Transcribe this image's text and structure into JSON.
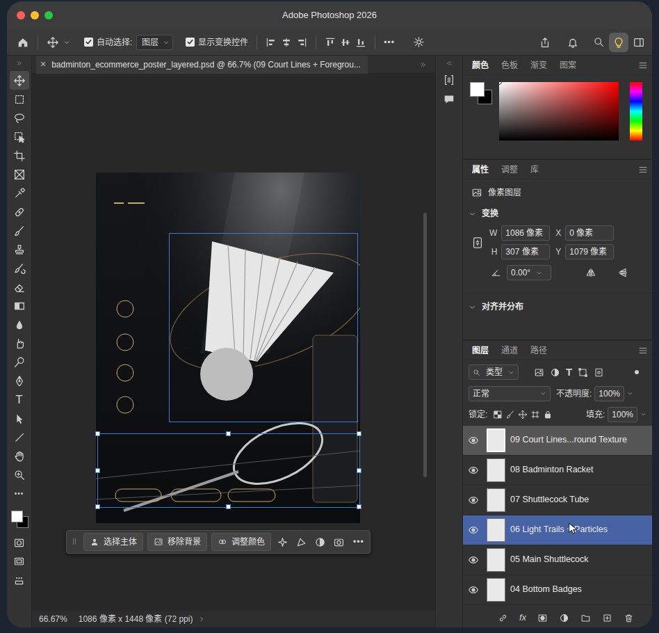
{
  "window": {
    "title": "Adobe Photoshop 2026"
  },
  "options_bar": {
    "auto_select": {
      "label": "自动选择:",
      "checked": true,
      "value": "图层"
    },
    "show_transform": {
      "label": "显示变换控件",
      "checked": true
    },
    "more": "•••",
    "discover_active": true
  },
  "document": {
    "tab": "badminton_ecommerce_poster_layered.psd @ 66.7% (09 Court Lines + Foregrou...",
    "close": "×"
  },
  "toolbar": {
    "tools": [
      {
        "kind": "move",
        "selected": true
      },
      {
        "kind": "marquee",
        "selected": false
      },
      {
        "kind": "lasso",
        "selected": false
      },
      {
        "kind": "object-select",
        "selected": false
      },
      {
        "kind": "crop",
        "selected": false
      },
      {
        "kind": "frame",
        "selected": false
      },
      {
        "kind": "eyedropper",
        "selected": false
      },
      {
        "kind": "healing",
        "selected": false
      },
      {
        "kind": "brush",
        "selected": false
      },
      {
        "kind": "stamp",
        "selected": false
      },
      {
        "kind": "history-brush",
        "selected": false
      },
      {
        "kind": "eraser",
        "selected": false
      },
      {
        "kind": "gradient",
        "selected": false
      },
      {
        "kind": "blur",
        "selected": false
      },
      {
        "kind": "smudge",
        "selected": false
      },
      {
        "kind": "dodge",
        "selected": false
      },
      {
        "kind": "pen",
        "selected": false
      },
      {
        "kind": "type",
        "label": "T",
        "selected": false
      },
      {
        "kind": "path-select",
        "selected": false
      },
      {
        "kind": "line",
        "selected": false
      },
      {
        "kind": "hand",
        "selected": false
      },
      {
        "kind": "zoom",
        "selected": false
      },
      {
        "kind": "more",
        "label": "•••",
        "selected": false
      }
    ],
    "foreground": "#ffffff",
    "background": "#000000"
  },
  "task_bar": {
    "buttons": [
      {
        "label": "选择主体"
      },
      {
        "label": "移除背景"
      },
      {
        "label": "调整颜色"
      }
    ],
    "more": "•••"
  },
  "status_bar": {
    "zoom": "66.67%",
    "info": "1086 像素 x 1448 像素 (72 ppi)"
  },
  "color_panel": {
    "tabs": [
      {
        "label": "颜色",
        "selected": true
      },
      {
        "label": "色板",
        "selected": false
      },
      {
        "label": "渐变",
        "selected": false
      },
      {
        "label": "图案",
        "selected": false
      }
    ],
    "foreground": "#ffffff",
    "background": "#000000",
    "hue": "#ff0000"
  },
  "properties_panel": {
    "tabs": [
      {
        "label": "属性",
        "selected": true
      },
      {
        "label": "调整",
        "selected": false
      },
      {
        "label": "库",
        "selected": false
      }
    ],
    "layer_type": "像素图层",
    "transform": {
      "title": "变换",
      "expanded": true,
      "fields": [
        {
          "label": "W",
          "value": "1086 像素"
        },
        {
          "label": "X",
          "value": "0 像素"
        },
        {
          "label": "H",
          "value": "307 像素"
        },
        {
          "label": "Y",
          "value": "1079 像素"
        }
      ],
      "angle": "0.00°"
    },
    "align": {
      "title": "对齐并分布",
      "expanded": true
    }
  },
  "layers_panel": {
    "tabs": [
      {
        "label": "图层",
        "selected": true
      },
      {
        "label": "通道",
        "selected": false
      },
      {
        "label": "路径",
        "selected": false
      }
    ],
    "filter": {
      "label": "类型",
      "type_icon": "T"
    },
    "blend_mode": "正常",
    "opacity": {
      "label": "不透明度:",
      "value": "100%"
    },
    "lock": {
      "label": "锁定:"
    },
    "fill": {
      "label": "填充:",
      "value": "100%"
    },
    "layers": [
      {
        "name": "09 Court Lines...round Texture",
        "visible": true,
        "selected": true,
        "hovered": false
      },
      {
        "name": "08 Badminton Racket",
        "visible": true,
        "selected": false,
        "hovered": false
      },
      {
        "name": "07 Shuttlecock Tube",
        "visible": true,
        "selected": false,
        "hovered": false
      },
      {
        "name": "06 Light Trails + Particles",
        "visible": true,
        "selected": false,
        "hovered": true
      },
      {
        "name": "05 Main Shuttlecock",
        "visible": true,
        "selected": false,
        "hovered": false
      },
      {
        "name": "04 Bottom Badges",
        "visible": true,
        "selected": false,
        "hovered": false
      }
    ],
    "fx": "fx"
  }
}
